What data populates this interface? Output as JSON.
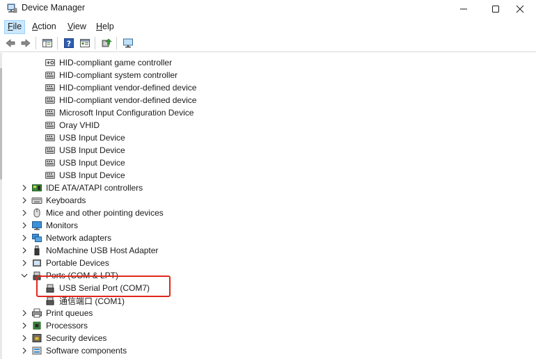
{
  "window": {
    "title": "Device Manager"
  },
  "menubar": {
    "items": [
      {
        "label": "File",
        "accel": "F",
        "rest": "ile"
      },
      {
        "label": "Action",
        "accel": "A",
        "rest": "ction"
      },
      {
        "label": "View",
        "accel": "V",
        "rest": "iew"
      },
      {
        "label": "Help",
        "accel": "H",
        "rest": "elp"
      }
    ]
  },
  "tree": {
    "hid_children": [
      "HID-compliant game controller",
      "HID-compliant system controller",
      "HID-compliant vendor-defined device",
      "HID-compliant vendor-defined device",
      "Microsoft Input Configuration Device",
      "Oray VHID",
      "USB Input Device",
      "USB Input Device",
      "USB Input Device",
      "USB Input Device"
    ],
    "categories": {
      "ide": "IDE ATA/ATAPI controllers",
      "keyboards": "Keyboards",
      "mice": "Mice and other pointing devices",
      "monitors": "Monitors",
      "network": "Network adapters",
      "nomachine": "NoMachine USB Host Adapter",
      "portable": "Portable Devices",
      "ports": "Ports (COM & LPT)",
      "print": "Print queues",
      "processors": "Processors",
      "security": "Security devices",
      "software": "Software components"
    },
    "ports_children": [
      "USB Serial Port (COM7)",
      "通信端口 (COM1)"
    ]
  },
  "colors": {
    "highlight_border": "#e0261d",
    "menu_active_bg": "#cce8ff"
  }
}
